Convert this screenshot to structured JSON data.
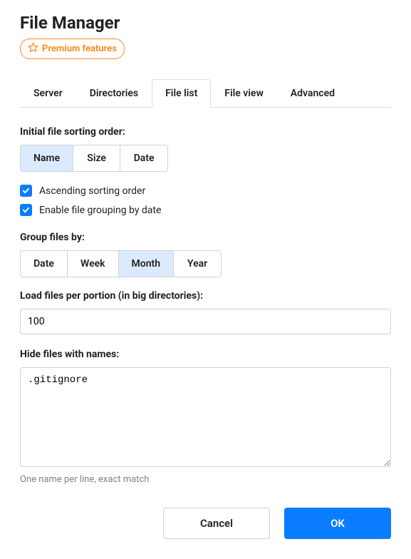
{
  "header": {
    "title": "File Manager",
    "premium_label": "Premium features"
  },
  "tabs": [
    {
      "label": "Server"
    },
    {
      "label": "Directories"
    },
    {
      "label": "File list"
    },
    {
      "label": "File view"
    },
    {
      "label": "Advanced"
    }
  ],
  "sorting": {
    "label": "Initial file sorting order:",
    "options": [
      "Name",
      "Size",
      "Date"
    ],
    "selected": "Name"
  },
  "checks": {
    "ascending_label": "Ascending sorting order",
    "grouping_label": "Enable file grouping by date"
  },
  "group": {
    "label": "Group files by:",
    "options": [
      "Date",
      "Week",
      "Month",
      "Year"
    ],
    "selected": "Month"
  },
  "portion": {
    "label": "Load files per portion (in big directories):",
    "value": "100"
  },
  "hide": {
    "label": "Hide files with names:",
    "value": ".gitignore",
    "help": "One name per line, exact match"
  },
  "buttons": {
    "cancel": "Cancel",
    "ok": "OK"
  }
}
